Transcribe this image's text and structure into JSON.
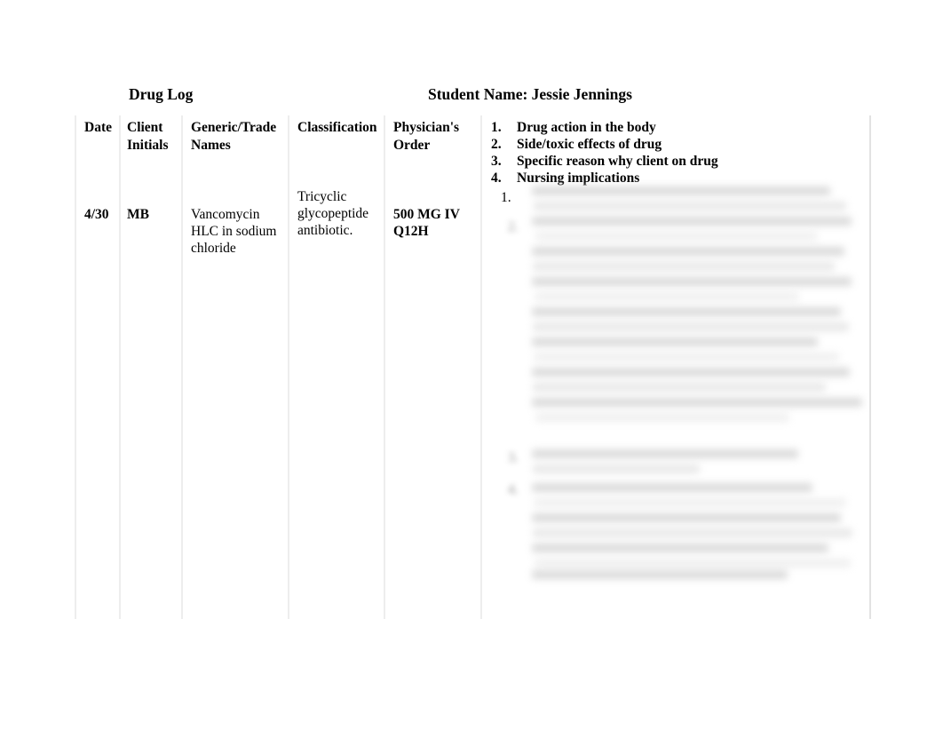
{
  "document": {
    "title": "Drug Log",
    "student_name_label": "Student Name: Jessie Jennings"
  },
  "table": {
    "columns": [
      {
        "key": "date",
        "header": "Date"
      },
      {
        "key": "client_initials",
        "header": "Client Initials"
      },
      {
        "key": "generic_trade",
        "header": "Generic/Trade Names"
      },
      {
        "key": "classification",
        "header": "Classification"
      },
      {
        "key": "physician_order",
        "header": "Physician's Order"
      },
      {
        "key": "notes",
        "header": ""
      }
    ],
    "header_cells": {
      "date": "Date",
      "client_initials_line1": "Client",
      "client_initials_line2": "Initials",
      "generic_trade_line1": "Generic/Trade",
      "generic_trade_line2": "Names",
      "classification": "Classification",
      "physician_order_line1": "Physician's",
      "physician_order_line2": "Order"
    },
    "header_notes_list": [
      {
        "number": "1.",
        "label": "Drug action in the body"
      },
      {
        "number": "2.",
        "label": "Side/toxic effects of drug"
      },
      {
        "number": "3.",
        "label": "Specific reason why client on drug"
      },
      {
        "number": "4.",
        "label": "Nursing implications"
      }
    ],
    "rows": [
      {
        "date": "4/30",
        "client_initials": "MB",
        "generic_trade_line1": "Vancomycin",
        "generic_trade_line2": "HLC in sodium",
        "generic_trade_line3": "chloride",
        "classification_line1": "Tricyclic",
        "classification_line2": "glycopeptide",
        "classification_line3": "antibiotic.",
        "physician_order_line1": "500 MG IV",
        "physician_order_line2": "Q12H",
        "notes_first_marker": "1.",
        "notes_redacted": true
      }
    ]
  },
  "colors": {
    "page_background": "#ffffff",
    "text": "#000000",
    "table_rule": "#ededed",
    "redaction_gray": "#d4d4d4"
  }
}
